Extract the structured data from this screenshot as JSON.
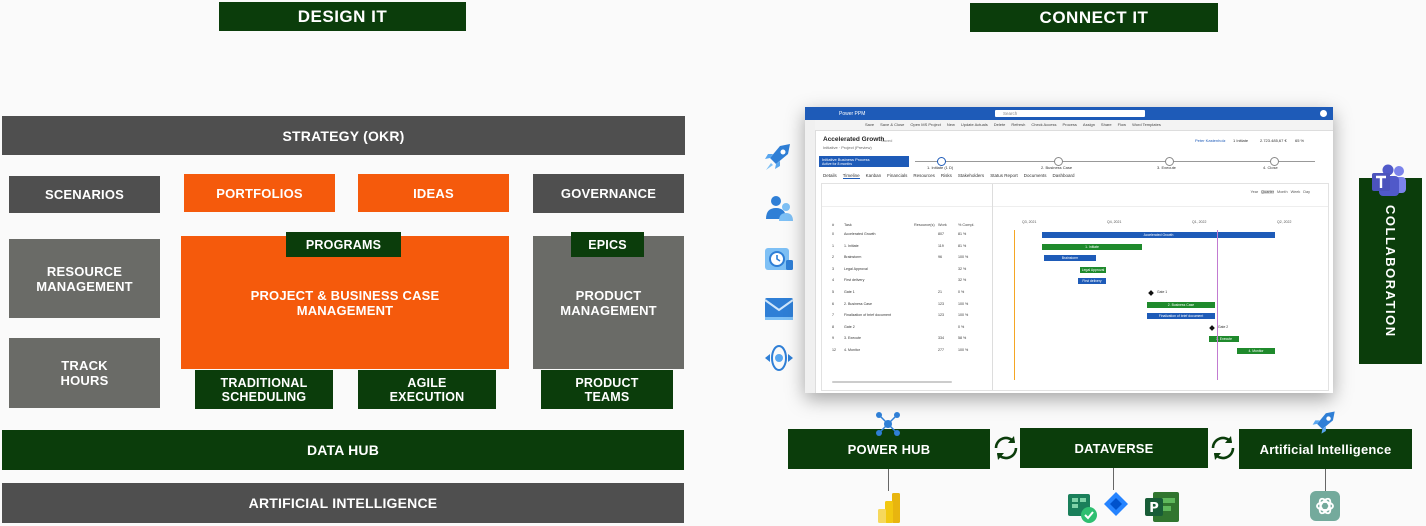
{
  "headers": {
    "design": "DESIGN IT",
    "connect": "CONNECT IT"
  },
  "design": {
    "strategy": "STRATEGY (OKR)",
    "scenarios": "SCENARIOS",
    "portfolios": "PORTFOLIOS",
    "ideas": "IDEAS",
    "governance": "GOVERNANCE",
    "resource_management": "RESOURCE MANAGEMENT",
    "programs": "PROGRAMS",
    "project_business_case": "PROJECT & BUSINESS CASE MANAGEMENT",
    "epics": "EPICS",
    "product_management": "PRODUCT MANAGEMENT",
    "track_hours": "TRACK HOURS",
    "traditional_scheduling": "TRADITIONAL SCHEDULING",
    "agile_execution": "AGILE EXECUTION",
    "product_teams": "PRODUCT TEAMS",
    "data_hub": "DATA HUB",
    "artificial_intelligence": "ARTIFICIAL INTELLIGENCE"
  },
  "connect": {
    "power_hub": "POWER HUB",
    "dataverse": "DATAVERSE",
    "ai": "Artificial Intelligence",
    "collaboration": "COLLABORATION"
  },
  "app_window": {
    "app_name": "Power PPM",
    "search_placeholder": "Search",
    "record_title": "Accelerated Growth",
    "record_status": "Saved",
    "record_sub": "Initiative · Project (Preview)",
    "owner": "Peter Kastenholz",
    "stage": "1 Initiate",
    "amount": "2.723.485,67 €",
    "progress": "65 %",
    "banner": "Initiative Business Process",
    "banner_sub": "Active for 8 months",
    "stages": [
      "1. Initiate (1 D)",
      "2. Business Case",
      "3. Execute",
      "4. Close"
    ],
    "tabs": [
      "Details",
      "Timeline",
      "Kanban",
      "Financials",
      "Resources",
      "Risks",
      "Stakeholders",
      "Status Report",
      "Documents",
      "Dashboard"
    ],
    "toolbar": [
      "Save",
      "Save & Close",
      "Open MS Project",
      "New",
      "Update Actuals",
      "Delete",
      "Refresh",
      "Check Access",
      "Process",
      "Assign",
      "Share",
      "Flow",
      "Word Templates"
    ],
    "grid_headers": [
      "#",
      "Task",
      "Resource(s)",
      "Work",
      "% Compl."
    ],
    "quarters": [
      "Q3, 2021",
      "Q4, 2021",
      "Q1, 2022",
      "Q2, 2022"
    ],
    "zoom_options": [
      "Year",
      "Quarter",
      "Month",
      "Week",
      "Day"
    ],
    "tasks": [
      {
        "n": "0",
        "name": "Accelerated Growth",
        "work": "807",
        "pct": "81 %"
      },
      {
        "n": "1",
        "name": "1. Initiate",
        "work": "119",
        "pct": "81 %"
      },
      {
        "n": "2",
        "name": "Brainstorm",
        "work": "96",
        "pct": "100 %"
      },
      {
        "n": "3",
        "name": "Legal Approval",
        "work": "",
        "pct": "32 %"
      },
      {
        "n": "4",
        "name": "First delivery",
        "work": "",
        "pct": "32 %"
      },
      {
        "n": "5",
        "name": "Gate 1",
        "work": "21",
        "pct": "0 %"
      },
      {
        "n": "6",
        "name": "2. Business Case",
        "work": "123",
        "pct": "100 %"
      },
      {
        "n": "7",
        "name": "Finalization of brief document",
        "work": "123",
        "pct": "100 %"
      },
      {
        "n": "8",
        "name": "Gate 2",
        "work": "",
        "pct": "0 %"
      },
      {
        "n": "9",
        "name": "3. Execute",
        "work": "334",
        "pct": "58 %"
      },
      {
        "n": "12",
        "name": "4. Monitor",
        "work": "277",
        "pct": "100 %"
      }
    ],
    "bar_labels": [
      "Accelerated Growth",
      "1. Initiate",
      "Brainstorm",
      "Legal Approval",
      "First delivery",
      "Gate 1",
      "2. Business Case",
      "Finalization of brief document",
      "Gate 2",
      "3. Execute",
      "4. Monitor"
    ]
  },
  "colors": {
    "dark_green": "#0b3d0b",
    "orange": "#f55a0c",
    "gray": "#595959",
    "brand_blue": "#1e5bb8"
  }
}
